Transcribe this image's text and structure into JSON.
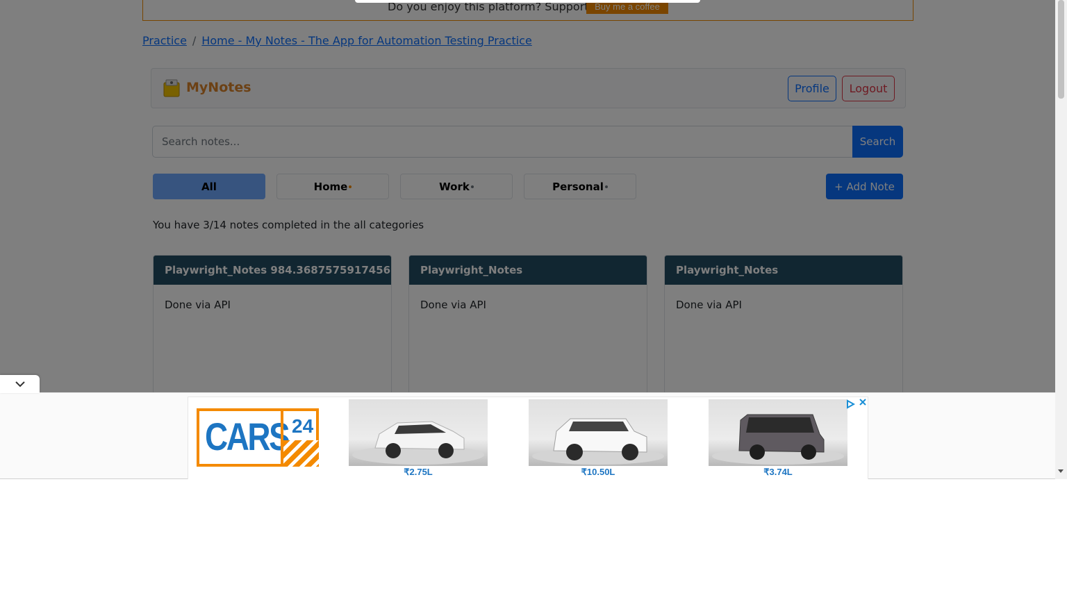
{
  "banner": {
    "text": "Do you enjoy this platform? Support us:",
    "button_label": "Buy me a coffee"
  },
  "breadcrumb": {
    "items": [
      "Practice",
      "Home - My Notes - The App for Automation Testing Practice"
    ],
    "separator": "/"
  },
  "navbar": {
    "brand": "MyNotes",
    "profile_label": "Profile",
    "logout_label": "Logout"
  },
  "search": {
    "placeholder": "Search notes...",
    "button_label": "Search"
  },
  "categories": [
    {
      "label": "All",
      "active": true,
      "dot_color": ""
    },
    {
      "label": "Home",
      "active": false,
      "dot_color": "#f48a00"
    },
    {
      "label": "Work",
      "active": false,
      "dot_color": "#6c757d"
    },
    {
      "label": "Personal",
      "active": false,
      "dot_color": "#6c757d"
    }
  ],
  "add_note_label": "+ Add Note",
  "status_text": "You have 3/14 notes completed in the all categories",
  "notes": [
    {
      "title": "Playwright_Notes 984.3687575917456",
      "description": "Done via API"
    },
    {
      "title": "Playwright_Notes",
      "description": "Done via API"
    },
    {
      "title": "Playwright_Notes",
      "description": "Done via API"
    }
  ],
  "ad": {
    "brand_text": "CARS",
    "brand_number": "24",
    "cars": [
      {
        "price": "₹2.75L",
        "color": "#f4f4f4"
      },
      {
        "price": "₹10.50L",
        "color": "#f8f8f8"
      },
      {
        "price": "₹3.74L",
        "color": "#5f5a60"
      }
    ]
  },
  "colors": {
    "primary": "#0d6efd",
    "danger": "#dc3545",
    "brand_orange": "#d9822b",
    "card_header": "#234d62"
  }
}
